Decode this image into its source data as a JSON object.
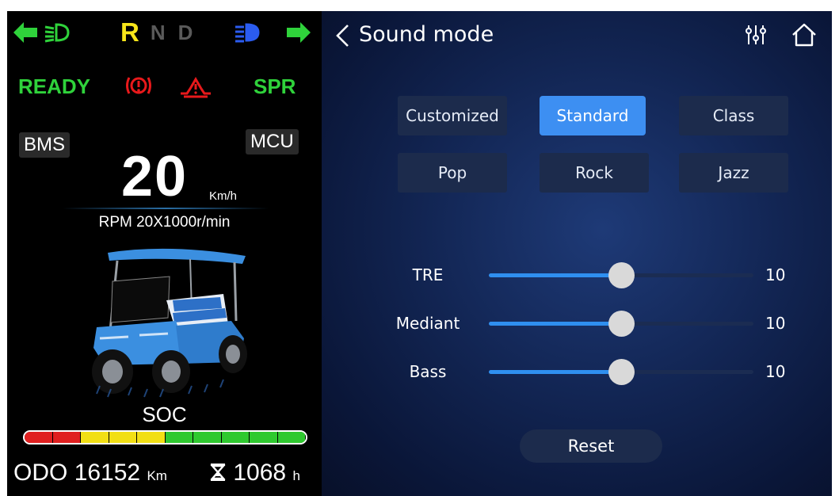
{
  "cluster": {
    "gears": [
      "R",
      "N",
      "D"
    ],
    "active_gear": "R",
    "status": {
      "ready": "READY",
      "spr": "SPR"
    },
    "bms": "BMS",
    "mcu": "MCU",
    "speed": "20",
    "speed_unit": "Km/h",
    "rpm": "RPM 20X1000r/min",
    "soc_label": "SOC",
    "soc_segments": [
      "#e02020",
      "#e02020",
      "#f2df14",
      "#f2df14",
      "#f2df14",
      "#2fc92f",
      "#2fc92f",
      "#2fc92f",
      "#2fc92f",
      "#2fc92f"
    ],
    "odo_label": "ODO",
    "odo_value": "16152",
    "odo_unit": "Km",
    "hours_value": "1068",
    "hours_unit": "h",
    "hours_icon": "hourglass-icon",
    "colors": {
      "green": "#2fd23b",
      "yellow": "#f7e51a",
      "red": "#e8191b",
      "blue": "#2b5cf0"
    }
  },
  "panel": {
    "title": "Sound mode",
    "modes": [
      {
        "label": "Customized",
        "active": false
      },
      {
        "label": "Standard",
        "active": true
      },
      {
        "label": "Class",
        "active": false
      },
      {
        "label": "Pop",
        "active": false
      },
      {
        "label": "Rock",
        "active": false
      },
      {
        "label": "Jazz",
        "active": false
      }
    ],
    "sliders": [
      {
        "label": "TRE",
        "value": "10",
        "level": 0.5
      },
      {
        "label": "Mediant",
        "value": "10",
        "level": 0.5
      },
      {
        "label": "Bass",
        "value": "10",
        "level": 0.5
      }
    ],
    "reset_label": "Reset",
    "accent": "#3d8ff2"
  }
}
